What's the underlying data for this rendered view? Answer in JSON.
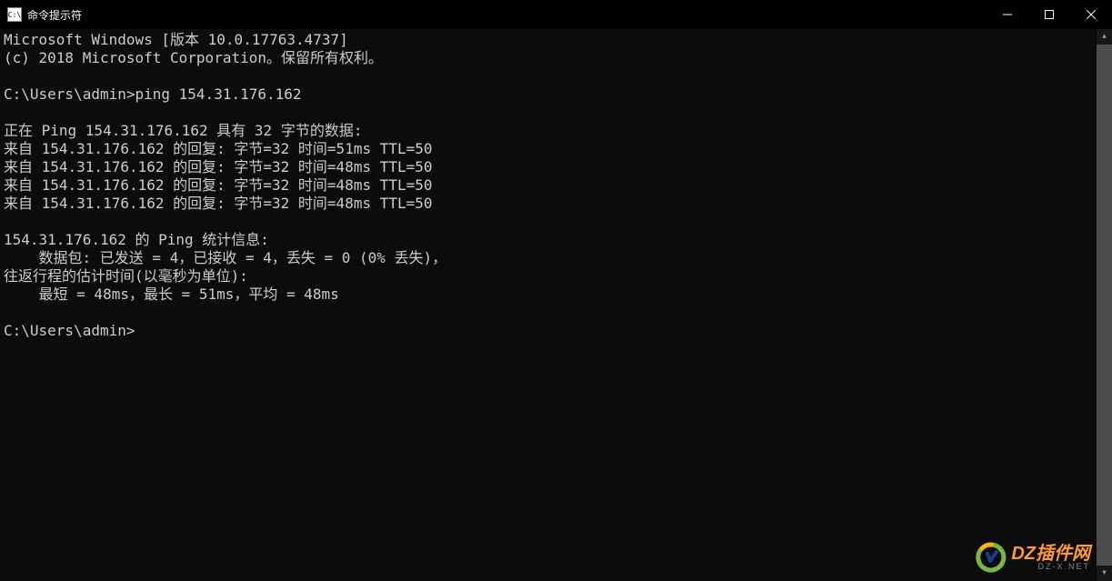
{
  "window": {
    "title": "命令提示符"
  },
  "terminal": {
    "lines": [
      "Microsoft Windows [版本 10.0.17763.4737]",
      "(c) 2018 Microsoft Corporation。保留所有权利。",
      "",
      "C:\\Users\\admin>ping 154.31.176.162",
      "",
      "正在 Ping 154.31.176.162 具有 32 字节的数据:",
      "来自 154.31.176.162 的回复: 字节=32 时间=51ms TTL=50",
      "来自 154.31.176.162 的回复: 字节=32 时间=48ms TTL=50",
      "来自 154.31.176.162 的回复: 字节=32 时间=48ms TTL=50",
      "来自 154.31.176.162 的回复: 字节=32 时间=48ms TTL=50",
      "",
      "154.31.176.162 的 Ping 统计信息:",
      "    数据包: 已发送 = 4，已接收 = 4，丢失 = 0 (0% 丢失)，",
      "往返行程的估计时间(以毫秒为单位):",
      "    最短 = 48ms，最长 = 51ms，平均 = 48ms",
      "",
      "C:\\Users\\admin>"
    ]
  },
  "watermark": {
    "main": "DZ插件网",
    "sub": "DZ-X.NET"
  }
}
